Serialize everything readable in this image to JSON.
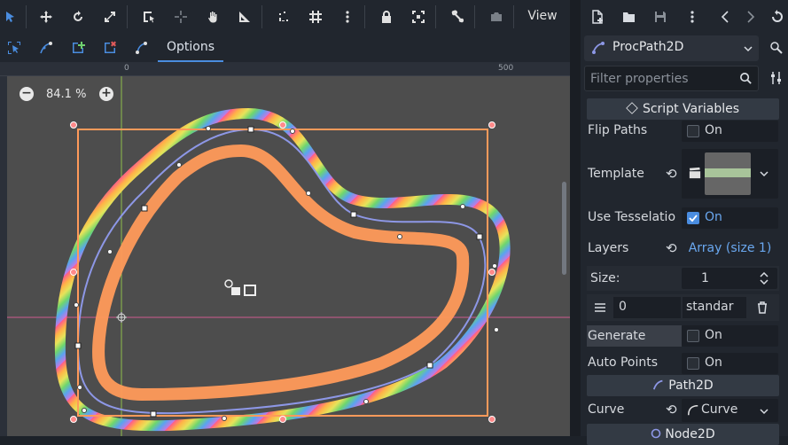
{
  "toolbar": {
    "tools": [
      "select-tool",
      "move-tool",
      "rotate-tool",
      "scale-tool",
      "list-select-tool",
      "pivot-tool",
      "pan-tool",
      "ruler-tool",
      "snap-tool",
      "grid-tool",
      "more-tool",
      "lock-tool",
      "group-tool",
      "bone-tool",
      "camera-tool"
    ],
    "view_label": "View"
  },
  "subbar": {
    "tools": [
      "select-points",
      "select-control-points",
      "add-point",
      "delete-point",
      "close-curve"
    ],
    "options_label": "Options"
  },
  "ruler": {
    "labels": [
      "0",
      "500"
    ]
  },
  "viewport": {
    "zoom": "84.1 %",
    "zoom_out": "−",
    "zoom_in": "+"
  },
  "inspector": {
    "node_name": "ProcPath2D",
    "filter_placeholder": "Filter properties",
    "sections": {
      "script_vars": "Script Variables",
      "path2d": "Path2D",
      "node2d": "Node2D"
    },
    "props": {
      "flip_paths": {
        "label": "Flip Paths",
        "value": "On"
      },
      "template": {
        "label": "Template"
      },
      "use_tess": {
        "label": "Use Tesselatio",
        "value": "On"
      },
      "layers": {
        "label": "Layers",
        "value": "Array (size 1)"
      },
      "size": {
        "label": "Size:",
        "value": "1"
      },
      "layer_item": {
        "index": "0",
        "value": "standar"
      },
      "generate": {
        "label": "Generate",
        "value": "On"
      },
      "auto_points": {
        "label": "Auto Points",
        "value": "On"
      },
      "curve": {
        "label": "Curve",
        "value": "Curve"
      }
    }
  },
  "colors": {
    "accent": "#4a8de0",
    "selection": "#ff9a5a",
    "curve": "#8d97e6"
  }
}
